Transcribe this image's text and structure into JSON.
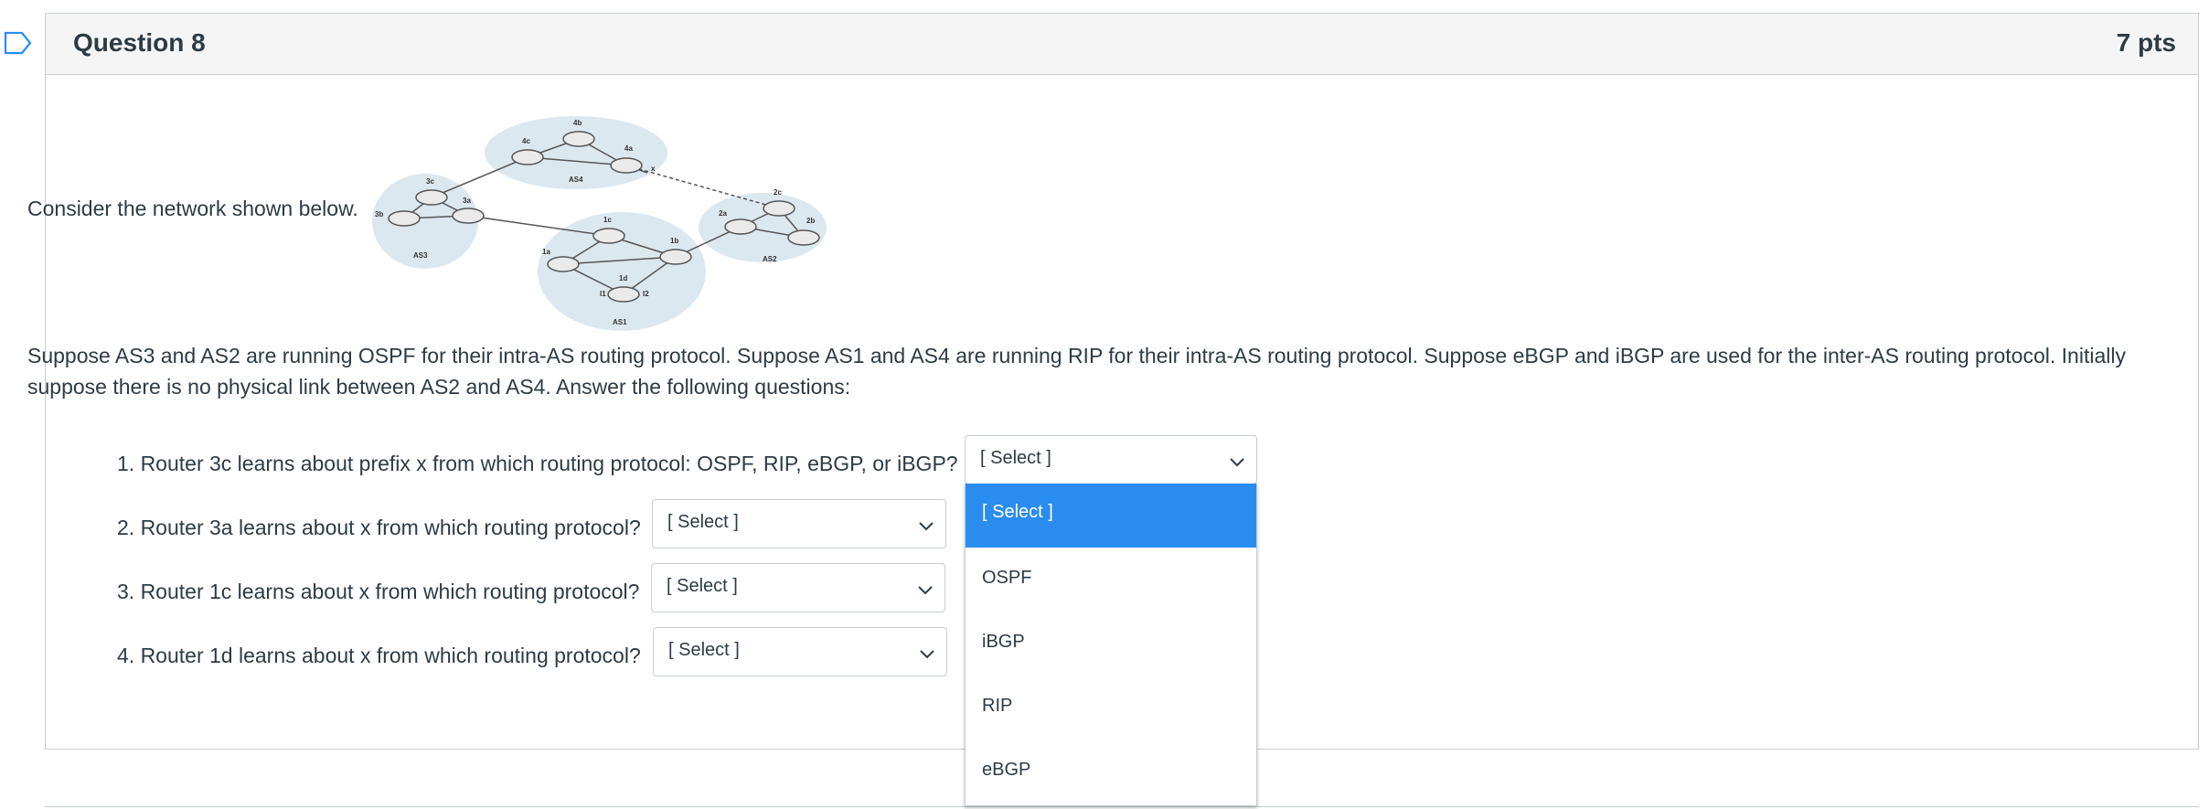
{
  "question": {
    "title": "Question 8",
    "points": "7 pts",
    "intro": "Consider the network shown below.",
    "body": "Suppose AS3 and AS2 are running OSPF for their intra-AS routing protocol. Suppose AS1 and AS4 are running RIP for their intra-AS routing protocol. Suppose eBGP and iBGP are used for the inter-AS routing protocol. Initially suppose there is no physical link between AS2 and AS4. Answer the following questions:"
  },
  "diagram": {
    "as_labels": [
      "AS4",
      "AS3",
      "AS1",
      "AS2"
    ],
    "routers": [
      "4c",
      "4b",
      "4a",
      "3c",
      "3a",
      "3b",
      "1c",
      "1a",
      "1b",
      "1d",
      "2a",
      "2c",
      "2b"
    ],
    "interfaces": [
      "I1",
      "I2"
    ],
    "prefix": "x"
  },
  "items": [
    {
      "text": "1. Router 3c learns about prefix x from which routing protocol: OSPF, RIP, eBGP, or iBGP?",
      "selected": "[ Select ]"
    },
    {
      "text": "2. Router 3a learns about x from which routing protocol?",
      "selected": "[ Select ]"
    },
    {
      "text": "3. Router 1c learns about x from which routing protocol?",
      "selected": "[ Select ]"
    },
    {
      "text": "4. Router 1d learns about x from which routing protocol?",
      "selected": "[ Select ]"
    }
  ],
  "dropdown": {
    "options": [
      "[ Select ]",
      "OSPF",
      "iBGP",
      "RIP",
      "eBGP"
    ],
    "highlight_color": "#2b8cf0"
  }
}
